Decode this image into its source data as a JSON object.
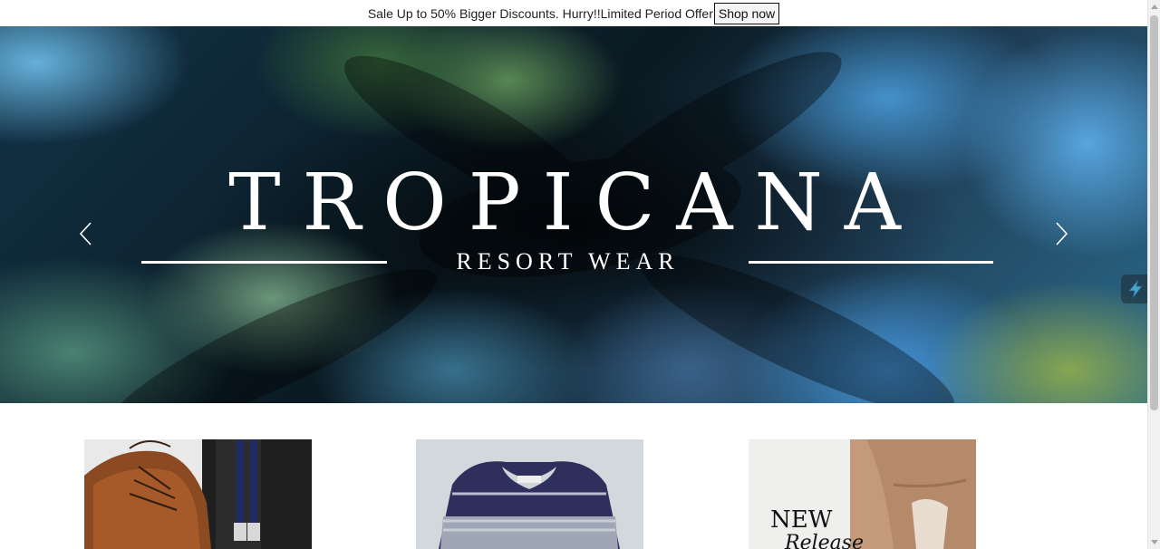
{
  "announcement": {
    "text": "Sale Up to 50% Bigger Discounts. Hurry!!Limited Period Offer",
    "button_label": "Shop now"
  },
  "hero": {
    "brand_title": "TROPICANA",
    "brand_subtitle": "RESORT WEAR",
    "prev_icon": "chevron-left-icon",
    "next_icon": "chevron-right-icon"
  },
  "side_widget": {
    "icon": "lightning-bolt-icon"
  },
  "products": [
    {
      "image": "brown leather shoes and navy suspenders"
    },
    {
      "image": "navy and grey knit sweater"
    },
    {
      "image_text_1": "NEW",
      "image_text_2": "Release"
    }
  ],
  "colors": {
    "accent": "#ffffff",
    "announcement_bg": "#ffffff",
    "button_bg": "#f4f4f4"
  }
}
